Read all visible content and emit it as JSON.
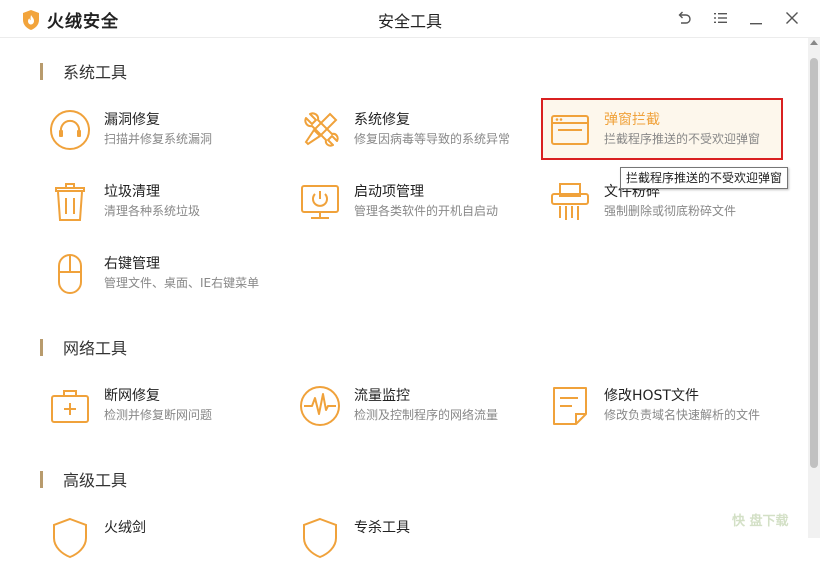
{
  "app": {
    "logo_text": "火绒安全",
    "window_title": "安全工具",
    "accent_color": "#f0a23b",
    "highlight_border_color": "#d92020"
  },
  "window_controls": {
    "back_icon": "undo-arrow-icon",
    "menu_icon": "hamburger-menu-icon",
    "minimize_icon": "minimize-icon",
    "close_icon": "close-icon"
  },
  "sections": {
    "system": {
      "title": "系统工具",
      "tools": [
        {
          "name": "漏洞修复",
          "desc": "扫描并修复系统漏洞",
          "icon": "vulnerability-fix-icon"
        },
        {
          "name": "系统修复",
          "desc": "修复因病毒等导致的系统异常",
          "icon": "wrench-screwdriver-icon"
        },
        {
          "name": "弹窗拦截",
          "desc": "拦截程序推送的不受欢迎弹窗",
          "icon": "popup-window-icon",
          "state": "hovered"
        },
        {
          "name": "垃圾清理",
          "desc": "清理各种系统垃圾",
          "icon": "trash-bin-icon"
        },
        {
          "name": "启动项管理",
          "desc": "管理各类软件的开机自启动",
          "icon": "startup-monitor-icon"
        },
        {
          "name": "文件粉碎",
          "desc": "强制删除或彻底粉碎文件",
          "icon": "shredder-icon"
        },
        {
          "name": "右键管理",
          "desc": "管理文件、桌面、IE右键菜单",
          "icon": "mouse-icon"
        }
      ]
    },
    "network": {
      "title": "网络工具",
      "tools": [
        {
          "name": "断网修复",
          "desc": "检测并修复断网问题",
          "icon": "network-repair-kit-icon"
        },
        {
          "name": "流量监控",
          "desc": "检测及控制程序的网络流量",
          "icon": "traffic-pulse-icon"
        },
        {
          "name": "修改HOST文件",
          "desc": "修改负责域名快速解析的文件",
          "icon": "host-file-icon"
        }
      ]
    },
    "advanced": {
      "title": "高级工具",
      "tools": [
        {
          "name": "火绒剑",
          "icon": "shield-icon"
        },
        {
          "name": "专杀工具",
          "icon": "shield-icon"
        }
      ]
    }
  },
  "tooltip": {
    "text": "拦截程序推送的不受欢迎弹窗"
  },
  "watermark": {
    "text": "快 盘下载"
  }
}
